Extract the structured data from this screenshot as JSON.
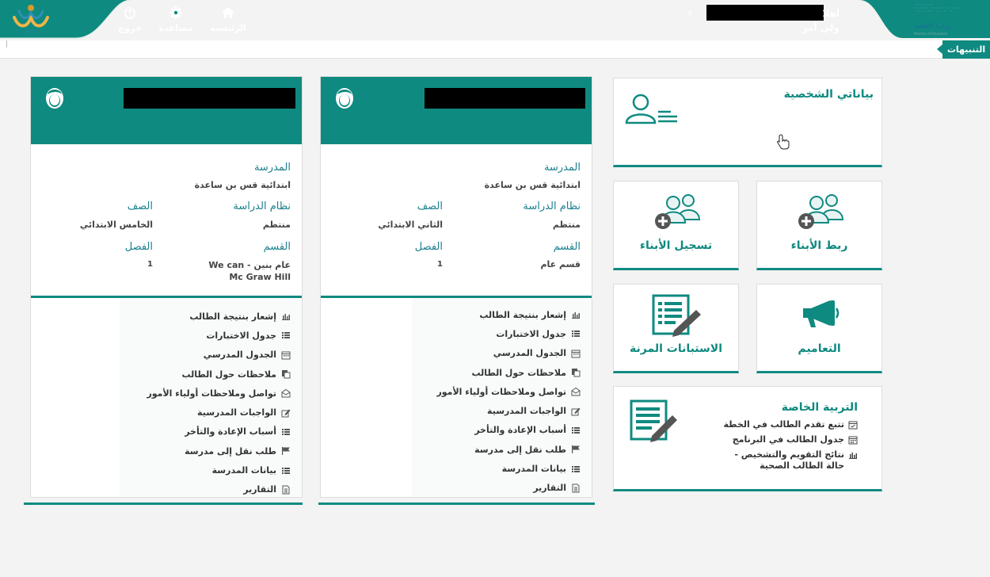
{
  "header": {
    "nav": [
      {
        "key": "home",
        "label": "الرئيسية",
        "icon": "home-icon"
      },
      {
        "key": "help",
        "label": "مساعدة",
        "icon": "gear-icon"
      },
      {
        "key": "logout",
        "label": "خروج",
        "icon": "power-icon"
      }
    ],
    "greeting": "أهلا",
    "role": "ولي أمر",
    "brand_logo": "NOOR",
    "ministry_logo": "وزارة التعليم",
    "ministry_logo_en": "Ministry of Education"
  },
  "alerts": {
    "label": "التنبيهات"
  },
  "tiles": {
    "personal": {
      "title": "بياناتي الشخصية",
      "icon": "user-card-icon"
    },
    "register_children": {
      "title": "تسجيل الأبناء",
      "icon": "add-users-icon"
    },
    "link_children": {
      "title": "ربط الأبناء",
      "icon": "add-users-icon"
    },
    "surveys": {
      "title": "الاستبانات المرنة",
      "icon": "survey-icon"
    },
    "circulars": {
      "title": "التعاميم",
      "icon": "megaphone-icon"
    },
    "special_ed": {
      "title": "التربية الخاصة",
      "icon": "notepad-icon",
      "items": [
        {
          "label": "تتبع تقدم الطالب في الخطة",
          "icon": "calendar-check-icon"
        },
        {
          "label": "جدول الطالب في البرنامج",
          "icon": "calendar-icon"
        },
        {
          "label": "نتائج التقويم والتشخيص - حالة الطالب الصحية",
          "icon": "bar-chart-icon"
        }
      ]
    }
  },
  "card_labels": {
    "school": "المدرسة",
    "study_system": "نظام الدراسة",
    "grade": "الصف",
    "section": "القسم",
    "class": "الفصل"
  },
  "students": [
    {
      "school": "ابتدائية قس بن ساعدة",
      "study_system": "منتظم",
      "grade": "الثاني الابتدائي",
      "section": "قسم عام",
      "class": "1"
    },
    {
      "school": "ابتدائية قس بن ساعدة",
      "study_system": "منتظم",
      "grade": "الخامس الابتدائي",
      "section": "عام بنين - We can Mc Graw Hill",
      "class": "1"
    }
  ],
  "student_menu": [
    {
      "label": "إشعار بنتيجة الطالب",
      "icon": "bar-chart-icon"
    },
    {
      "label": "جدول الاختبارات",
      "icon": "list-icon"
    },
    {
      "label": "الجدول المدرسي",
      "icon": "calendar-icon"
    },
    {
      "label": "ملاحظات حول الطالب",
      "icon": "copy-icon"
    },
    {
      "label": "تواصل وملاحظات أولياء الأمور",
      "icon": "envelope-icon"
    },
    {
      "label": "الواجبات المدرسية",
      "icon": "edit-icon"
    },
    {
      "label": "أسباب الإعادة والتأخر",
      "icon": "list-icon"
    },
    {
      "label": "طلب نقل إلى مدرسة",
      "icon": "flag-icon"
    },
    {
      "label": "بيانات المدرسة",
      "icon": "list-icon"
    },
    {
      "label": "التقارير",
      "icon": "file-icon"
    }
  ],
  "colors": {
    "accent": "#0f8a80",
    "label_blue": "#1b7f8d",
    "page_bg": "#f2f3f2"
  }
}
